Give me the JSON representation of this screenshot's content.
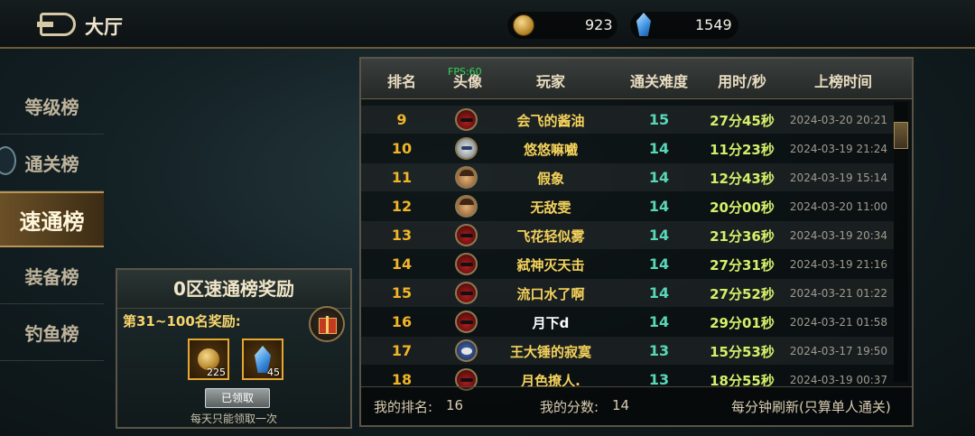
{
  "header": {
    "title": "大厅",
    "gold": "923",
    "gems": "1549"
  },
  "tabs": [
    {
      "label": "等级榜",
      "active": false
    },
    {
      "label": "通关榜",
      "active": false
    },
    {
      "label": "速通榜",
      "active": true
    },
    {
      "label": "装备榜",
      "active": false
    },
    {
      "label": "钓鱼榜",
      "active": false
    }
  ],
  "reward": {
    "title": "0区速通榜奖励",
    "rank_range": "第31~100名奖励:",
    "items": [
      {
        "icon": "gold-coin-icon",
        "count": "225"
      },
      {
        "icon": "blue-gem-icon",
        "count": "45"
      }
    ],
    "claim_label": "已领取",
    "daily_note": "每天只能领取一次"
  },
  "board": {
    "fps": "FPS:60",
    "headers": [
      "排名",
      "头像",
      "玩家",
      "通关难度",
      "用时/秒",
      "上榜时间"
    ],
    "rows": [
      {
        "rank": "9",
        "avatar": "red-mask-avatar",
        "name": "会飞的酱油",
        "difficulty": "15",
        "time": "27分45秒",
        "date": "2024-03-20 20:21"
      },
      {
        "rank": "10",
        "avatar": "cat-avatar",
        "name": "悠悠嘛嚱",
        "difficulty": "14",
        "time": "11分23秒",
        "date": "2024-03-19 21:24"
      },
      {
        "rank": "11",
        "avatar": "face-avatar",
        "name": "假象",
        "difficulty": "14",
        "time": "12分43秒",
        "date": "2024-03-19 15:14"
      },
      {
        "rank": "12",
        "avatar": "face-avatar",
        "name": "无敌雯",
        "difficulty": "14",
        "time": "20分00秒",
        "date": "2024-03-20 11:00"
      },
      {
        "rank": "13",
        "avatar": "red-mask-avatar",
        "name": "飞花轻似雾",
        "difficulty": "14",
        "time": "21分36秒",
        "date": "2024-03-19 20:34"
      },
      {
        "rank": "14",
        "avatar": "red-mask-avatar",
        "name": "弑神灭天击",
        "difficulty": "14",
        "time": "27分31秒",
        "date": "2024-03-19 21:16"
      },
      {
        "rank": "15",
        "avatar": "red-mask-avatar",
        "name": "流口水了啊",
        "difficulty": "14",
        "time": "27分52秒",
        "date": "2024-03-21 01:22"
      },
      {
        "rank": "16",
        "avatar": "red-mask-avatar",
        "name": "月下d",
        "difficulty": "14",
        "time": "29分01秒",
        "date": "2024-03-21 01:58",
        "self": true
      },
      {
        "rank": "17",
        "avatar": "blue-knight-avatar",
        "name": "王大锤的寂寞",
        "difficulty": "13",
        "time": "15分53秒",
        "date": "2024-03-17 19:50"
      },
      {
        "rank": "18",
        "avatar": "red-mask-avatar",
        "name": "月色撩人.",
        "difficulty": "13",
        "time": "18分55秒",
        "date": "2024-03-19 00:37"
      }
    ],
    "footer": {
      "my_rank_label": "我的排名:",
      "my_rank": "16",
      "my_score_label": "我的分数:",
      "my_score": "14",
      "refresh_note": "每分钟刷新(只算单人通关)"
    }
  }
}
